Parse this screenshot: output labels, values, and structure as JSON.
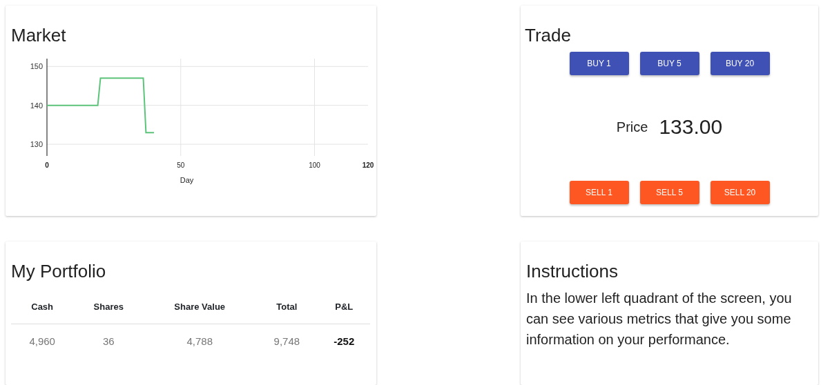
{
  "market": {
    "title": "Market",
    "chart_data": {
      "type": "line",
      "xlabel": "Day",
      "x": [
        0,
        19,
        20,
        36,
        37,
        40
      ],
      "grid": true,
      "series": [
        {
          "color": "#5cc47a",
          "values": [
            140,
            140,
            147,
            147,
            133,
            133
          ]
        }
      ],
      "xlim": [
        0,
        120
      ],
      "ylim": [
        127,
        152
      ],
      "xticks": [
        0,
        50,
        100,
        120
      ],
      "yticks": [
        130,
        140,
        150
      ]
    }
  },
  "trade": {
    "title": "Trade",
    "buy_buttons": [
      "BUY 1",
      "BUY 5",
      "BUY 20"
    ],
    "price_label": "Price",
    "price_value": "133.00",
    "sell_buttons": [
      "SELL 1",
      "SELL 5",
      "SELL 20"
    ]
  },
  "portfolio": {
    "title": "My Portfolio",
    "columns": [
      "Cash",
      "Shares",
      "Share Value",
      "Total",
      "P&L"
    ],
    "row": [
      "4,960",
      "36",
      "4,788",
      "9,748",
      "-252"
    ]
  },
  "instructions": {
    "title": "Instructions",
    "text": "In the lower left quadrant of the screen, you can see various metrics that give you some information on your performance."
  }
}
